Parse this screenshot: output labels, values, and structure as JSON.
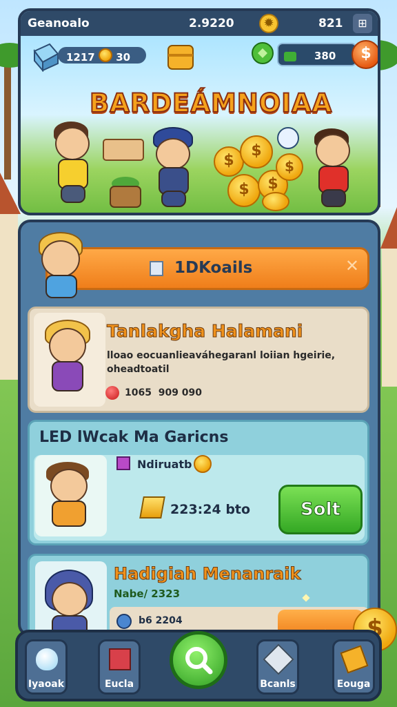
{
  "topbar": {
    "player_name": "Geanoalo",
    "center_value": "2.9220",
    "score": "821",
    "menu_icon": "menu-icon"
  },
  "header": {
    "left_counter": "1217",
    "left_coin_value": "30",
    "right_counter": "380",
    "title": "BARDEÁMNOIAA"
  },
  "banner": {
    "label": "1DKoails"
  },
  "card1": {
    "title": "Tanlakgha Halamani",
    "desc_line1": "lloao eocuanlieaváhegaranl loiian hgeirie,",
    "desc_line2": "oheadtoatil",
    "stats": "1065  909 090"
  },
  "card2": {
    "title": "LED lWcak Ma Garicns",
    "sub": "Ndiruatb",
    "amount": "223:24 bto",
    "button": "Solt"
  },
  "card3": {
    "title": "Hadigiah Menanraik",
    "sub": "Nabe/ 2323",
    "value": "b6 2204"
  },
  "nav": [
    {
      "label": "Iyaoak",
      "icon": "egg-icon"
    },
    {
      "label": "Eucla",
      "icon": "gift-box-icon"
    },
    {
      "label": "",
      "icon": "search-icon"
    },
    {
      "label": "Bcanls",
      "icon": "pin-icon"
    },
    {
      "label": "Eouga",
      "icon": "ticket-icon"
    }
  ],
  "colors": {
    "accent_orange": "#f0921c",
    "panel_blue": "#4f7ca3",
    "dark_navy": "#263a55",
    "green_button": "#34a824"
  }
}
